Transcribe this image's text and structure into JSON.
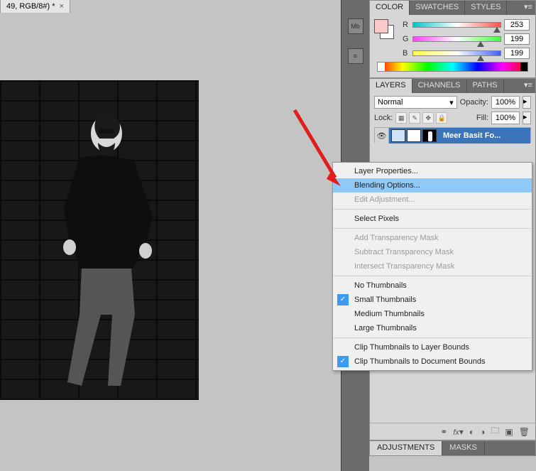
{
  "document": {
    "tab_title": "49, RGB/8#) *",
    "close_glyph": "×"
  },
  "color_panel": {
    "tabs": [
      "COLOR",
      "SWATCHES",
      "STYLES"
    ],
    "channels": {
      "r": {
        "label": "R",
        "value": "253"
      },
      "g": {
        "label": "G",
        "value": "199"
      },
      "b": {
        "label": "B",
        "value": "199"
      }
    }
  },
  "layers_panel": {
    "tabs": [
      "LAYERS",
      "CHANNELS",
      "PATHS"
    ],
    "blend_mode": "Normal",
    "opacity_label": "Opacity:",
    "opacity_value": "100%",
    "lock_label": "Lock:",
    "fill_label": "Fill:",
    "fill_value": "100%",
    "layer_name": "Meer Basit Fo..."
  },
  "adjustments_panel": {
    "tabs": [
      "ADJUSTMENTS",
      "MASKS"
    ]
  },
  "context_menu": {
    "items": [
      {
        "label": "Layer Properties...",
        "disabled": false
      },
      {
        "label": "Blending Options...",
        "disabled": false,
        "highlighted": true
      },
      {
        "label": "Edit Adjustment...",
        "disabled": true
      },
      {
        "sep": true
      },
      {
        "label": "Select Pixels",
        "disabled": false
      },
      {
        "sep": true
      },
      {
        "label": "Add Transparency Mask",
        "disabled": true
      },
      {
        "label": "Subtract Transparency Mask",
        "disabled": true
      },
      {
        "label": "Intersect Transparency Mask",
        "disabled": true
      },
      {
        "sep": true
      },
      {
        "label": "No Thumbnails",
        "disabled": false
      },
      {
        "label": "Small Thumbnails",
        "disabled": false,
        "checked": true
      },
      {
        "label": "Medium Thumbnails",
        "disabled": false
      },
      {
        "label": "Large Thumbnails",
        "disabled": false
      },
      {
        "sep": true
      },
      {
        "label": "Clip Thumbnails to Layer Bounds",
        "disabled": false
      },
      {
        "label": "Clip Thumbnails to Document Bounds",
        "disabled": false,
        "checked": true
      }
    ]
  },
  "dock": {
    "icon1": "Mb",
    "icon2": "≡"
  }
}
